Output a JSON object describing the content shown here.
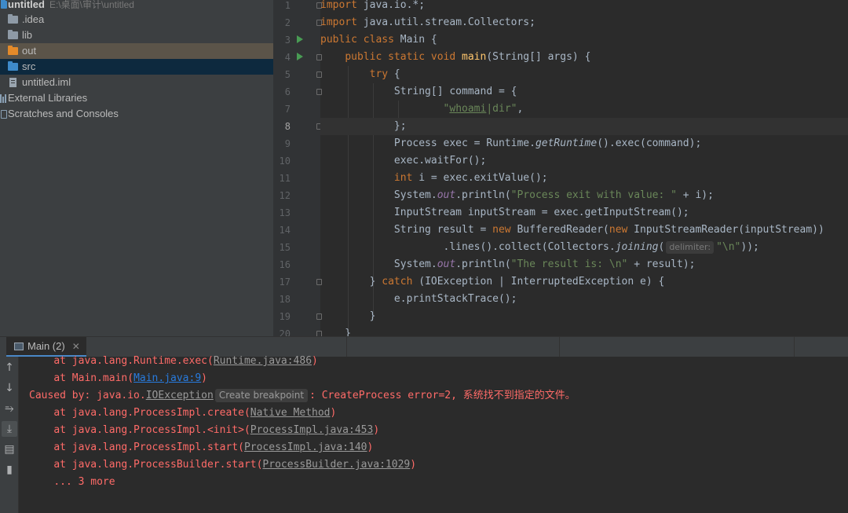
{
  "project": {
    "name": "untitled",
    "path": "E:\\桌面\\审计\\untitled",
    "items": [
      {
        "label": ".idea"
      },
      {
        "label": "lib"
      },
      {
        "label": "out"
      },
      {
        "label": "src"
      },
      {
        "label": "untitled.iml"
      },
      {
        "label": "External Libraries"
      },
      {
        "label": "Scratches and Consoles"
      }
    ]
  },
  "editor": {
    "line_numbers": [
      "1",
      "2",
      "3",
      "4",
      "5",
      "6",
      "7",
      "8",
      "9",
      "10",
      "11",
      "12",
      "13",
      "14",
      "15",
      "16",
      "17",
      "18",
      "19",
      "20"
    ],
    "current_line": "8",
    "param_hint": "delimiter:"
  },
  "run": {
    "tab_label": "Main (2)",
    "console": {
      "l1_prefix": "at java.lang.Runtime.exec(",
      "l1_link": "Runtime.java:486",
      "l1_suffix": ")",
      "l2_prefix": "at Main.main(",
      "l2_link": "Main.java:9",
      "l2_suffix": ")",
      "l3_prefix": "Caused by: java.io.",
      "l3_link": "IOException",
      "l3_popup": "Create breakpoint",
      "l3_suffix": ": CreateProcess error=2, ",
      "l3_cn": "系统找不到指定的文件。",
      "l4_prefix": "at java.lang.ProcessImpl.create(",
      "l4_link": "Native Method",
      "l4_suffix": ")",
      "l5_prefix": "at java.lang.ProcessImpl.<init>(",
      "l5_link": "ProcessImpl.java:453",
      "l5_suffix": ")",
      "l6_prefix": "at java.lang.ProcessImpl.start(",
      "l6_link": "ProcessImpl.java:140",
      "l6_suffix": ")",
      "l7_prefix": "at java.lang.ProcessBuilder.start(",
      "l7_link": "ProcessBuilder.java:1029",
      "l7_suffix": ")",
      "l8": "... 3 more"
    }
  }
}
